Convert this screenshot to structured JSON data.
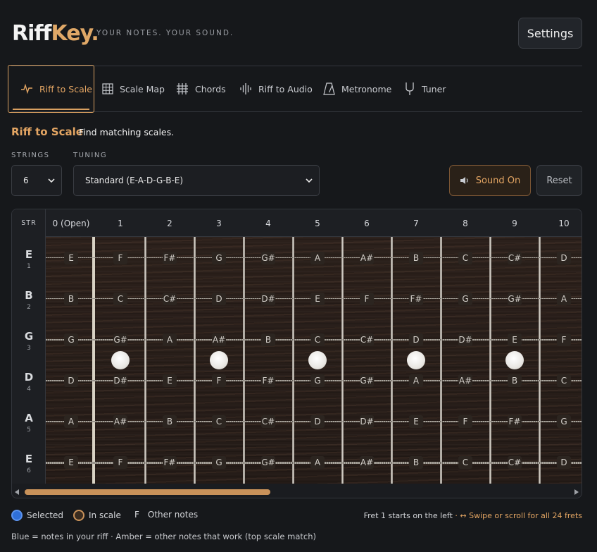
{
  "app": {
    "logo_main": "Riff",
    "logo_accent": "Key.",
    "tagline": "YOUR NOTES. YOUR SOUND.",
    "settings_label": "Settings",
    "accent_color": "#e3a563"
  },
  "tabs": [
    {
      "label": "Riff to Scale",
      "icon": "waveform-icon",
      "active": true
    },
    {
      "label": "Scale Map",
      "icon": "grid-icon",
      "active": false
    },
    {
      "label": "Chords",
      "icon": "chord-grid-icon",
      "active": false
    },
    {
      "label": "Riff to Audio",
      "icon": "audio-bars-icon",
      "active": false
    },
    {
      "label": "Metronome",
      "icon": "metronome-icon",
      "active": false
    },
    {
      "label": "Tuner",
      "icon": "tuning-fork-icon",
      "active": false
    }
  ],
  "section": {
    "title": "Riff to Scale",
    "subtitle": "Find matching scales."
  },
  "controls": {
    "strings_label": "STRINGS",
    "strings_value": "6",
    "tuning_label": "TUNING",
    "tuning_value": "Standard (E-A-D-G-B-E)",
    "sound_label": "Sound On",
    "reset_label": "Reset"
  },
  "fretboard": {
    "str_header": "STR",
    "fret_labels": [
      "0 (Open)",
      "1",
      "2",
      "3",
      "4",
      "5",
      "6",
      "7",
      "8",
      "9",
      "10"
    ],
    "strings": [
      {
        "name": "E",
        "num": "1",
        "notes": [
          "E",
          "F",
          "F#",
          "G",
          "G#",
          "A",
          "A#",
          "B",
          "C",
          "C#",
          "D"
        ]
      },
      {
        "name": "B",
        "num": "2",
        "notes": [
          "B",
          "C",
          "C#",
          "D",
          "D#",
          "E",
          "F",
          "F#",
          "G",
          "G#",
          "A"
        ]
      },
      {
        "name": "G",
        "num": "3",
        "notes": [
          "G",
          "G#",
          "A",
          "A#",
          "B",
          "C",
          "C#",
          "D",
          "D#",
          "E",
          "F"
        ]
      },
      {
        "name": "D",
        "num": "4",
        "notes": [
          "D",
          "D#",
          "E",
          "F",
          "F#",
          "G",
          "G#",
          "A",
          "A#",
          "B",
          "C"
        ]
      },
      {
        "name": "A",
        "num": "5",
        "notes": [
          "A",
          "A#",
          "B",
          "C",
          "C#",
          "D",
          "D#",
          "E",
          "F",
          "F#",
          "G"
        ]
      },
      {
        "name": "E",
        "num": "6",
        "notes": [
          "E",
          "F",
          "F#",
          "G",
          "G#",
          "A",
          "A#",
          "B",
          "C",
          "C#",
          "D"
        ]
      }
    ],
    "inlay_frets": [
      1,
      3,
      5,
      7,
      9
    ],
    "scroll_fraction": 0.43
  },
  "legend": {
    "selected": "Selected",
    "in_scale": "In scale",
    "other_symbol": "F",
    "other": "Other notes",
    "fret_hint": "Fret 1 starts on the left",
    "swipe_hint": "· ↔ Swipe or scroll for all 24 frets",
    "footnote": "Blue = notes in your riff · Amber = other notes that work (top scale match)"
  }
}
